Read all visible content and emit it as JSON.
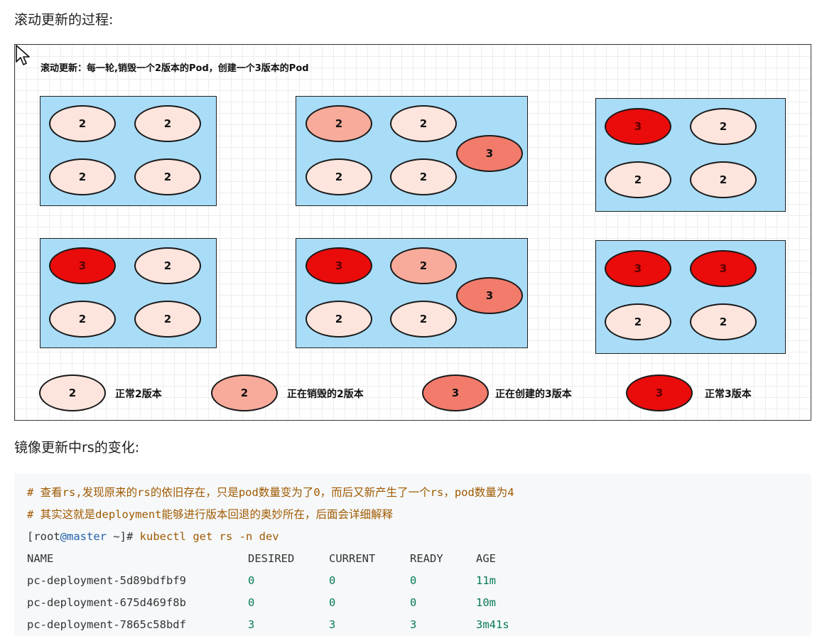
{
  "headings": {
    "rolling": "滚动更新的过程:",
    "rs_change": "镜像更新中rs的变化:"
  },
  "diagram": {
    "title": "滚动更新：每一轮,销毁一个2版本的Pod，创建一个3版本的Pod",
    "colors": {
      "normal2": "#fde5de",
      "destroy2": "#f8ab9b",
      "create3": "#f27b6b",
      "normal3": "#ea0b0b",
      "group_bg": "#a9dcf7"
    },
    "groups": [
      {
        "pods": [
          {
            "label": "2",
            "state": "normal2"
          },
          {
            "label": "2",
            "state": "normal2"
          },
          {
            "label": "2",
            "state": "normal2"
          },
          {
            "label": "2",
            "state": "normal2"
          }
        ]
      },
      {
        "pods": [
          {
            "label": "2",
            "state": "destroy2"
          },
          {
            "label": "2",
            "state": "normal2"
          },
          {
            "label": "2",
            "state": "normal2"
          },
          {
            "label": "2",
            "state": "normal2"
          },
          {
            "label": "3",
            "state": "create3"
          }
        ]
      },
      {
        "pods": [
          {
            "label": "3",
            "state": "normal3"
          },
          {
            "label": "2",
            "state": "normal2"
          },
          {
            "label": "2",
            "state": "normal2"
          },
          {
            "label": "2",
            "state": "normal2"
          }
        ]
      },
      {
        "pods": [
          {
            "label": "3",
            "state": "normal3"
          },
          {
            "label": "2",
            "state": "normal2"
          },
          {
            "label": "2",
            "state": "normal2"
          },
          {
            "label": "2",
            "state": "normal2"
          }
        ]
      },
      {
        "pods": [
          {
            "label": "3",
            "state": "normal3"
          },
          {
            "label": "2",
            "state": "destroy2"
          },
          {
            "label": "2",
            "state": "normal2"
          },
          {
            "label": "2",
            "state": "normal2"
          },
          {
            "label": "3",
            "state": "create3"
          }
        ]
      },
      {
        "pods": [
          {
            "label": "3",
            "state": "normal3"
          },
          {
            "label": "3",
            "state": "normal3"
          },
          {
            "label": "2",
            "state": "normal2"
          },
          {
            "label": "2",
            "state": "normal2"
          }
        ]
      }
    ],
    "legend": [
      {
        "label": "2",
        "state": "normal2",
        "text": "正常2版本"
      },
      {
        "label": "2",
        "state": "destroy2",
        "text": "正在销毁的2版本"
      },
      {
        "label": "3",
        "state": "create3",
        "text": "正在创建的3版本"
      },
      {
        "label": "3",
        "state": "normal3",
        "text": "正常3版本"
      }
    ]
  },
  "code": {
    "comment1": "# 查看rs,发现原来的rs的依旧存在，只是pod数量变为了0，而后又新产生了一个rs，pod数量为4",
    "comment2": "# 其实这就是deployment能够进行版本回退的奥妙所在，后面会详细解释",
    "prompt_open": "[root",
    "prompt_host": "@master",
    "prompt_rest": " ~]# ",
    "command": "kubectl get rs -n dev",
    "table": {
      "headers": [
        "NAME",
        "DESIRED",
        "CURRENT",
        "READY",
        "AGE"
      ],
      "rows": [
        [
          "pc-deployment-5d89bdfbf9",
          "0",
          "0",
          "0",
          "11m"
        ],
        [
          "pc-deployment-675d469f8b",
          "0",
          "0",
          "0",
          "10m"
        ],
        [
          "pc-deployment-7865c58bdf",
          "3",
          "3",
          "3",
          "3m41s"
        ]
      ]
    }
  }
}
